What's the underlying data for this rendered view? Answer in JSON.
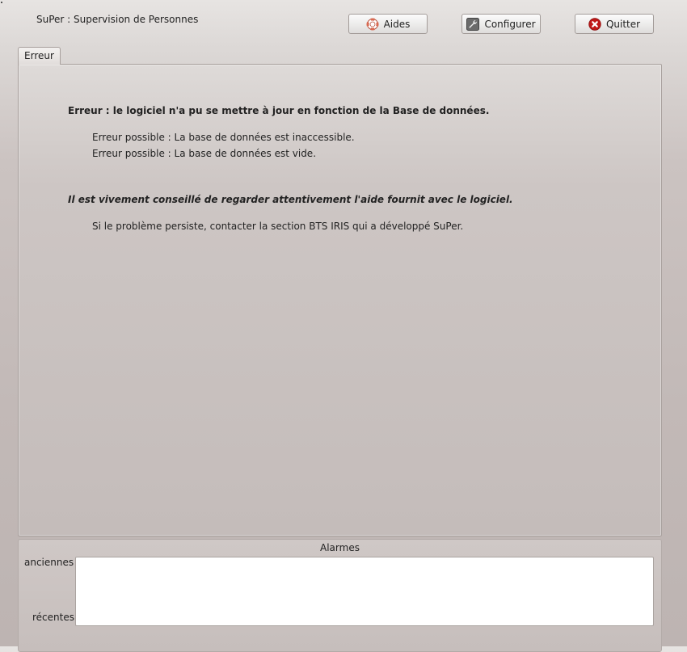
{
  "header": {
    "title": "SuPer : Supervision de Personnes",
    "buttons": {
      "aides": {
        "label": "Aides",
        "icon": "lifebuoy-icon"
      },
      "configurer": {
        "label": "Configurer",
        "icon": "wrench-icon"
      },
      "quitter": {
        "label": "Quitter",
        "icon": "close-circle-icon"
      }
    }
  },
  "tabs": [
    {
      "label": "Erreur",
      "active": true
    }
  ],
  "error_panel": {
    "heading": "Erreur : le logiciel n'a pu se mettre à jour en fonction de la Base de données.",
    "possible_errors": [
      "Erreur possible : La base de données est inaccessible.",
      "Erreur possible : La base de données est vide."
    ],
    "advice": "Il est vivement conseillé de regarder attentivement l'aide fournit avec le logiciel.",
    "contact": "Si le problème persiste, contacter la section BTS IRIS qui a développé SuPer."
  },
  "alarms": {
    "title": "Alarmes",
    "old_label": "anciennes",
    "recent_label": "récentes"
  },
  "colors": {
    "quit_icon": "#c01818",
    "aides_icon": "#d0533a",
    "config_icon": "#555555"
  }
}
